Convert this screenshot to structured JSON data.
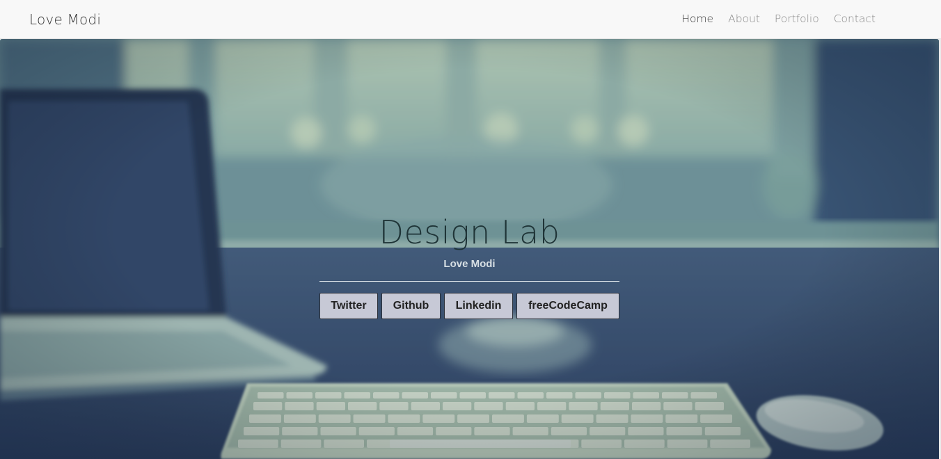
{
  "navbar": {
    "brand": "Love Modi",
    "links": [
      "Home",
      "About",
      "Portfolio",
      "Contact"
    ],
    "active_link": "Home"
  },
  "hero": {
    "title": "Design Lab",
    "subtitle": "Love Modi",
    "buttons": [
      "Twitter",
      "Github",
      "Linkedin",
      "freeCodeCamp"
    ]
  },
  "colors": {
    "navbar_bg": "#f8f8f8",
    "hero_overlay": "#34496e",
    "button_bg": "#c7c9d6",
    "title_color": "#1f3437"
  }
}
